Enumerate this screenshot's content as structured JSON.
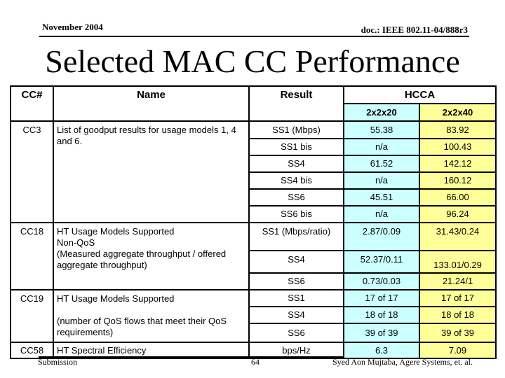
{
  "header": {
    "date": "November 2004",
    "doc_id": "doc.: IEEE 802.11-04/888r3"
  },
  "title": "Selected MAC CC Performance",
  "table": {
    "headers": {
      "cc": "CC#",
      "name": "Name",
      "result": "Result",
      "group": "HCCA",
      "sub1": "2x2x20",
      "sub2": "2x2x40"
    },
    "colors": {
      "col_2x2x20": "#ccffff",
      "col_2x2x40": "#ffff99"
    },
    "groups": [
      {
        "cc": "CC3",
        "name": "List of goodput results for usage models 1, 4 and 6.",
        "rows": [
          {
            "result": "SS1 (Mbps)",
            "v20": "55.38",
            "v40": "83.92"
          },
          {
            "result": "SS1 bis",
            "v20": "n/a",
            "v40": "100.43"
          },
          {
            "result": "SS4",
            "v20": "61.52",
            "v40": "142.12"
          },
          {
            "result": "SS4 bis",
            "v20": "n/a",
            "v40": "160.12"
          },
          {
            "result": "SS6",
            "v20": "45.51",
            "v40": "66.00"
          },
          {
            "result": "SS6 bis",
            "v20": "n/a",
            "v40": "96.24"
          }
        ]
      },
      {
        "cc": "CC18",
        "name_lines": [
          "HT Usage Models Supported",
          "Non-QoS",
          "(Measured aggregate throughput / offered aggregate throughput)"
        ],
        "rows": [
          {
            "result": "SS1 (Mbps/ratio)",
            "v20": "2.87/0.09",
            "v40": "31.43/0.24"
          },
          {
            "result": "SS4",
            "v20": "52.37/0.11",
            "v40": "133.01/0.29"
          },
          {
            "result": "SS6",
            "v20": "0.73/0.03",
            "v40": "21.24/1"
          }
        ]
      },
      {
        "cc": "CC19",
        "name_lines": [
          "HT Usage Models Supported",
          "(number of QoS flows that meet their QoS requirements)"
        ],
        "rows": [
          {
            "result": "SS1",
            "v20": "17 of 17",
            "v40": "17 of 17"
          },
          {
            "result": "SS4",
            "v20": "18 of 18",
            "v40": "18 of 18"
          },
          {
            "result": "SS6",
            "v20": "39 of 39",
            "v40": "39 of 39"
          }
        ]
      },
      {
        "cc": "CC58",
        "name": "HT Spectral Efficiency",
        "rows": [
          {
            "result": "bps/Hz",
            "v20": "6.3",
            "v40": "7.09"
          }
        ]
      }
    ]
  },
  "footer": {
    "left": "Submission",
    "page": "64",
    "author": "Syed Aon Mujtaba, Agere Systems, et. al."
  }
}
